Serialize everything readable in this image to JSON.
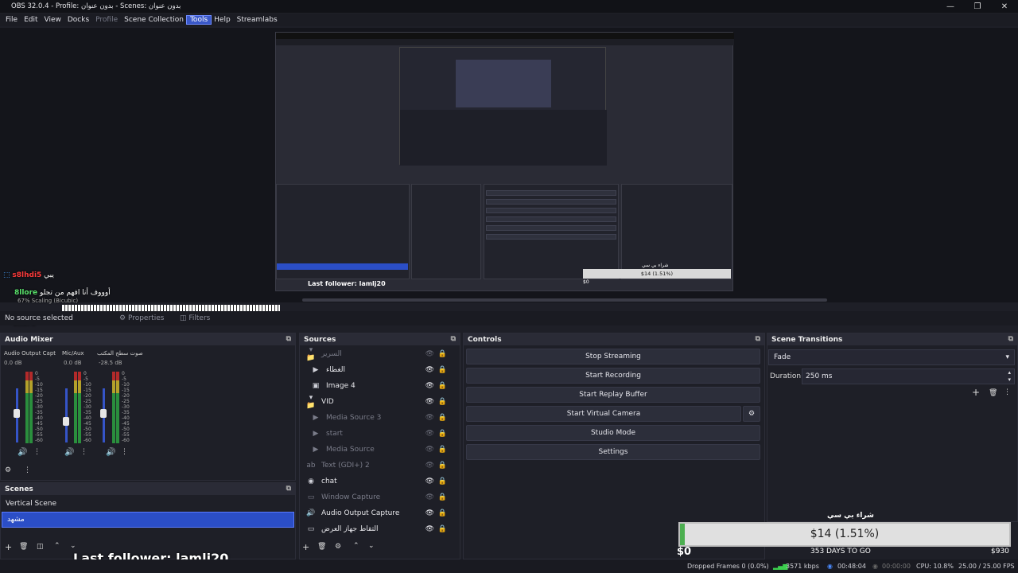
{
  "window": {
    "title": "OBS 32.0.4 - Profile: بدون عنوان - Scenes: بدون عنوان",
    "min": "—",
    "max": "❐",
    "close": "✕"
  },
  "menu": [
    {
      "label": "File"
    },
    {
      "label": "Edit"
    },
    {
      "label": "View"
    },
    {
      "label": "Docks"
    },
    {
      "label": "Profile"
    },
    {
      "label": "Scene Collection"
    },
    {
      "label": "Tools"
    },
    {
      "label": "Help"
    },
    {
      "label": "Streamlabs"
    }
  ],
  "overlay": {
    "chat": [
      {
        "name": "s8lhdi5",
        "msg": "يبي"
      },
      {
        "name": "8llore",
        "msg": "أوووف أنا افهم من تجلو"
      },
      {
        "name": "8llore",
        "msg": ""
      },
      {
        "name": "8llore",
        "msg": ""
      },
      {
        "name": "s8lhdi5",
        "msg": ""
      }
    ],
    "no_source": "No source selected",
    "last_follower": "Last follower: lamlj20",
    "scaling": "Scaling (Bicubic)",
    "pct": "67%"
  },
  "nested": {
    "goal_title": "شراء بي سي",
    "goal_value": "$14 (1.51%)",
    "goal_min": "$0",
    "last_follower": "Last follower: lamlj20"
  },
  "propbar": {
    "properties": "Properties",
    "filters": "Filters"
  },
  "audio": {
    "title": "Audio Mixer",
    "channels": [
      {
        "name": "Audio Output Capt",
        "db": "0.0 dB"
      },
      {
        "name": "Mic/Aux",
        "db": "0.0 dB"
      },
      {
        "name": "صوت سطح المكتب",
        "db": "-28.5 dB"
      }
    ],
    "scale": [
      "0",
      "-5",
      "-10",
      "-15",
      "-20",
      "-25",
      "-30",
      "-35",
      "-40",
      "-45",
      "-50",
      "-55",
      "-60"
    ]
  },
  "scenes": {
    "title": "Scenes",
    "items": [
      {
        "label": "Vertical Scene"
      },
      {
        "label": "مشهد"
      }
    ]
  },
  "sources": {
    "title": "Sources",
    "items": [
      {
        "label": "السرير",
        "dim": true
      },
      {
        "label": "الغطاء",
        "dim": false
      },
      {
        "label": "Image 4",
        "dim": false
      },
      {
        "label": "VID",
        "dim": false
      },
      {
        "label": "Media Source 3",
        "dim": true
      },
      {
        "label": "start",
        "dim": true
      },
      {
        "label": "Media Source",
        "dim": true
      },
      {
        "label": "Text (GDI+) 2",
        "dim": true
      },
      {
        "label": "chat",
        "dim": false
      },
      {
        "label": "Window Capture",
        "dim": true
      },
      {
        "label": "Audio Output Capture",
        "dim": false
      },
      {
        "label": "التقاط جهاز العرض",
        "dim": false
      }
    ]
  },
  "controls": {
    "title": "Controls",
    "stop_streaming": "Stop Streaming",
    "start_recording": "Start Recording",
    "start_replay": "Start Replay Buffer",
    "start_vcam": "Start Virtual Camera",
    "studio_mode": "Studio Mode",
    "settings": "Settings"
  },
  "transitions": {
    "title": "Scene Transitions",
    "selected": "Fade",
    "duration_label": "Duration",
    "duration_value": "250 ms"
  },
  "goal": {
    "title": "شراء بي سي",
    "value": "$14 (1.51%)",
    "fraction": 0.0151,
    "min": "$0",
    "days": "353 DAYS TO GO",
    "max": "$930"
  },
  "status": {
    "dropped": "Dropped Frames 0 (0.0%)",
    "kbps": "3571 kbps",
    "live_time": "00:48:04",
    "rec_time": "00:00:00",
    "cpu": "CPU: 10.8%",
    "fps": "25.00 / 25.00 FPS"
  },
  "colors": {
    "accent": "#3a58c9",
    "selection": "#2b4ec6",
    "panel": "#1e1f27",
    "header": "#2a2b36",
    "button": "#2c2e3a"
  }
}
